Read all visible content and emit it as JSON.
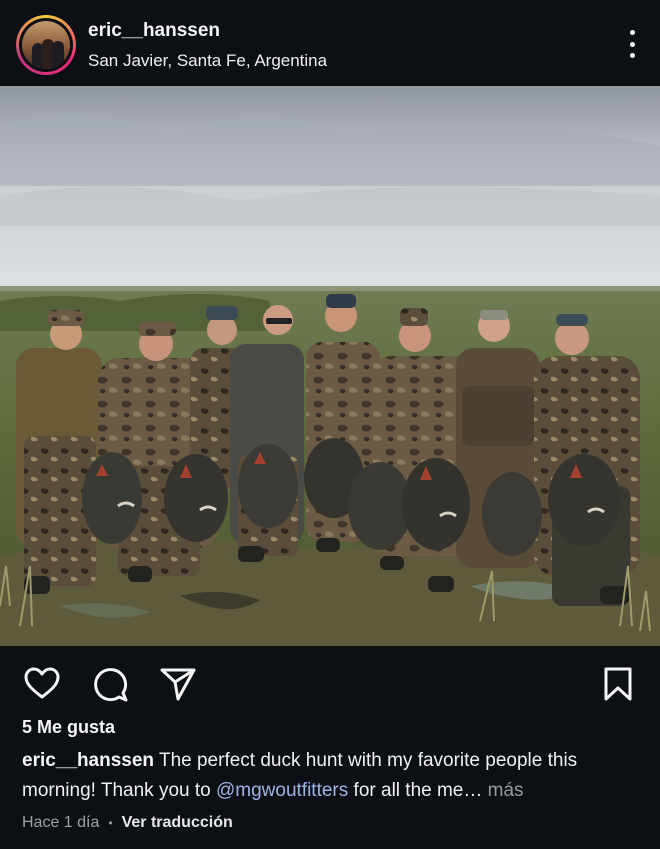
{
  "post": {
    "username": "eric__hanssen",
    "location": "San Javier, Santa Fe, Argentina",
    "likes": "5 Me gusta",
    "caption_user": "eric__hanssen",
    "caption_text_1": " The perfect duck hunt with my favorite people this morning! Thank you to ",
    "caption_mention": "@mgwoutfitters",
    "caption_text_2": " for all the me…",
    "caption_more": " más",
    "timestamp": "Hace 1 día",
    "translate": "Ver traducción"
  },
  "icons": {
    "like": "heart-icon",
    "comment": "comment-icon",
    "share": "paper-plane-icon",
    "save": "bookmark-icon",
    "more": "more-vertical-icon"
  },
  "colors": {
    "background": "#0c0f14",
    "mention": "#9fb4e6",
    "avatar_ring": "#ee2a7b"
  }
}
